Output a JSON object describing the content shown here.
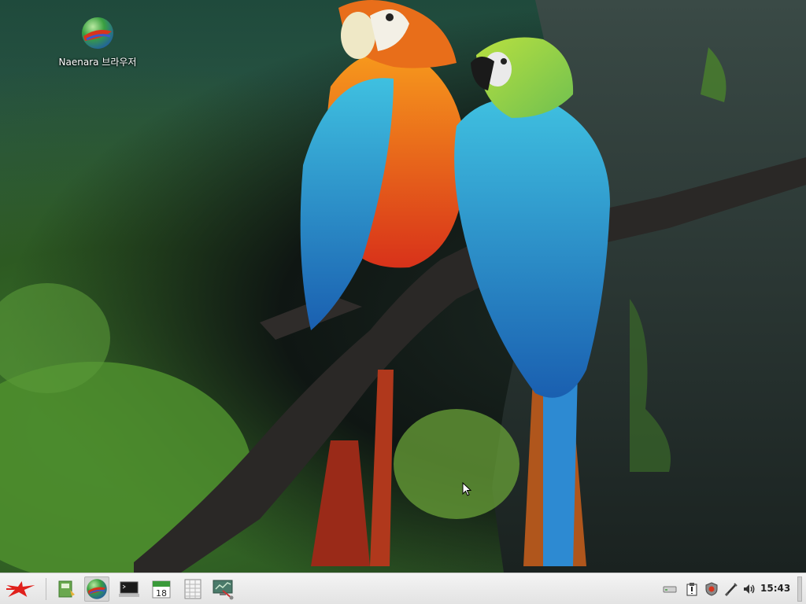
{
  "desktop": {
    "icons": [
      {
        "label": "Naenara 브라우저",
        "icon": "naenara-globe-icon"
      }
    ]
  },
  "taskbar": {
    "start_icon": "red-star-menu-icon",
    "launchers": [
      {
        "icon": "file-manager-icon"
      },
      {
        "icon": "naenara-browser-icon"
      },
      {
        "icon": "terminal-icon"
      },
      {
        "icon": "calendar-icon",
        "text": "18"
      },
      {
        "icon": "spreadsheet-icon"
      },
      {
        "icon": "system-monitor-icon"
      }
    ],
    "tray": [
      {
        "icon": "removable-drive-icon"
      },
      {
        "icon": "clipboard-icon"
      },
      {
        "icon": "security-shield-icon"
      },
      {
        "icon": "network-icon"
      },
      {
        "icon": "volume-icon"
      }
    ],
    "clock": "15:43"
  },
  "colors": {
    "taskbar_bg": "#e8e8e8",
    "star_red": "#e0201b"
  }
}
